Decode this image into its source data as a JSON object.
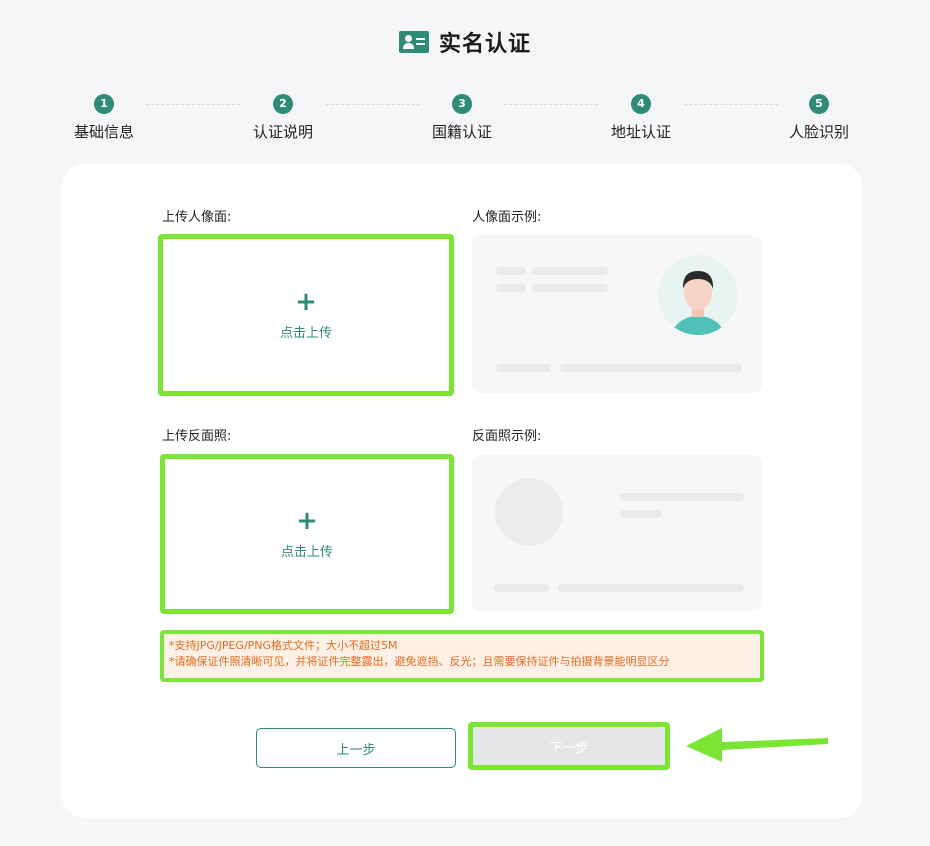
{
  "header": {
    "title": "实名认证",
    "icon": "id-card-icon"
  },
  "steps": [
    {
      "num": "1",
      "label": "基础信息"
    },
    {
      "num": "2",
      "label": "认证说明"
    },
    {
      "num": "3",
      "label": "国籍认证"
    },
    {
      "num": "4",
      "label": "地址认证"
    },
    {
      "num": "5",
      "label": "人脸识别"
    }
  ],
  "upload": {
    "front_label": "上传人像面:",
    "front_sample_label": "人像面示例:",
    "back_label": "上传反面照:",
    "back_sample_label": "反面照示例:",
    "plus": "+",
    "click_text": "点击上传"
  },
  "tips": {
    "line1": "*支持JPG/JPEG/PNG格式文件；大小不超过5M",
    "line2": "*请确保证件照清晰可见，并将证件完整露出，避免遮挡、反光；且需要保持证件与拍摄背景能明显区分"
  },
  "buttons": {
    "prev": "上一步",
    "next": "下一步"
  },
  "colors": {
    "accent": "#2e8b76",
    "highlight": "#7be533",
    "warning": "#e56a1f"
  }
}
